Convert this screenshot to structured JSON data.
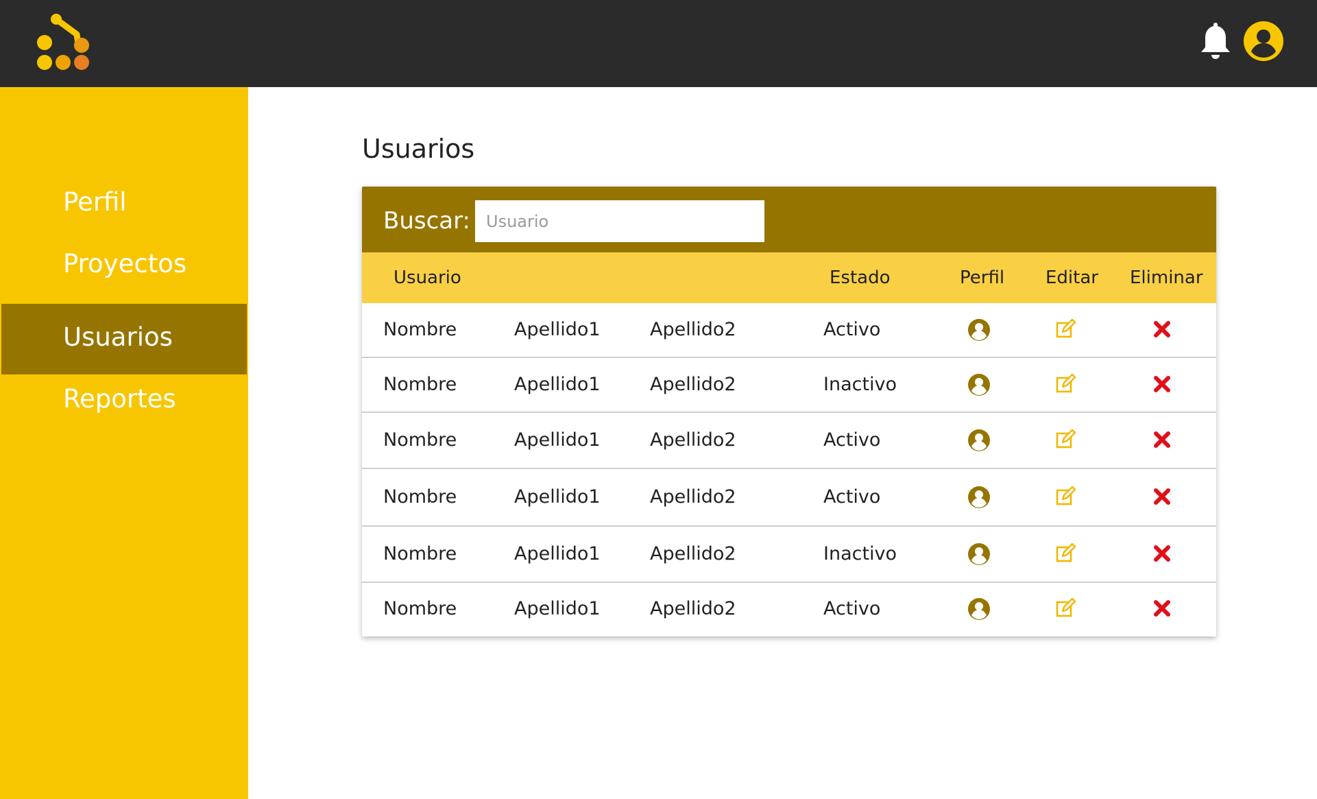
{
  "header": {
    "logo_icon": "logo-icon",
    "notification_icon": "bell-icon",
    "account_icon": "user-circle-icon"
  },
  "sidebar": {
    "items": [
      {
        "label": "Perfil",
        "active": false
      },
      {
        "label": "Proyectos",
        "active": false
      },
      {
        "label": "Usuarios",
        "active": true
      },
      {
        "label": "Reportes",
        "active": false
      }
    ]
  },
  "main": {
    "title": "Usuarios",
    "search": {
      "label": "Buscar:",
      "placeholder": "Usuario",
      "value": ""
    },
    "table": {
      "columns": [
        "Usuario",
        "Estado",
        "Perfil",
        "Editar",
        "Eliminar"
      ],
      "rows": [
        {
          "nombre": "Nombre",
          "apellido1": "Apellido1",
          "apellido2": "Apellido2",
          "estado": "Activo"
        },
        {
          "nombre": "Nombre",
          "apellido1": "Apellido1",
          "apellido2": "Apellido2",
          "estado": "Inactivo"
        },
        {
          "nombre": "Nombre",
          "apellido1": "Apellido1",
          "apellido2": "Apellido2",
          "estado": "Activo"
        },
        {
          "nombre": "Nombre",
          "apellido1": "Apellido1",
          "apellido2": "Apellido2",
          "estado": "Activo"
        },
        {
          "nombre": "Nombre",
          "apellido1": "Apellido1",
          "apellido2": "Apellido2",
          "estado": "Inactivo"
        },
        {
          "nombre": "Nombre",
          "apellido1": "Apellido1",
          "apellido2": "Apellido2",
          "estado": "Activo"
        }
      ],
      "row_icons": {
        "perfil": "user-circle-icon",
        "editar": "edit-icon",
        "eliminar": "delete-x-icon"
      }
    }
  },
  "colors": {
    "topbar": "#2b2b2b",
    "sidebar": "#f8c600",
    "accent_dark": "#957500",
    "table_header": "#f9cf44",
    "delete": "#e0101a"
  }
}
